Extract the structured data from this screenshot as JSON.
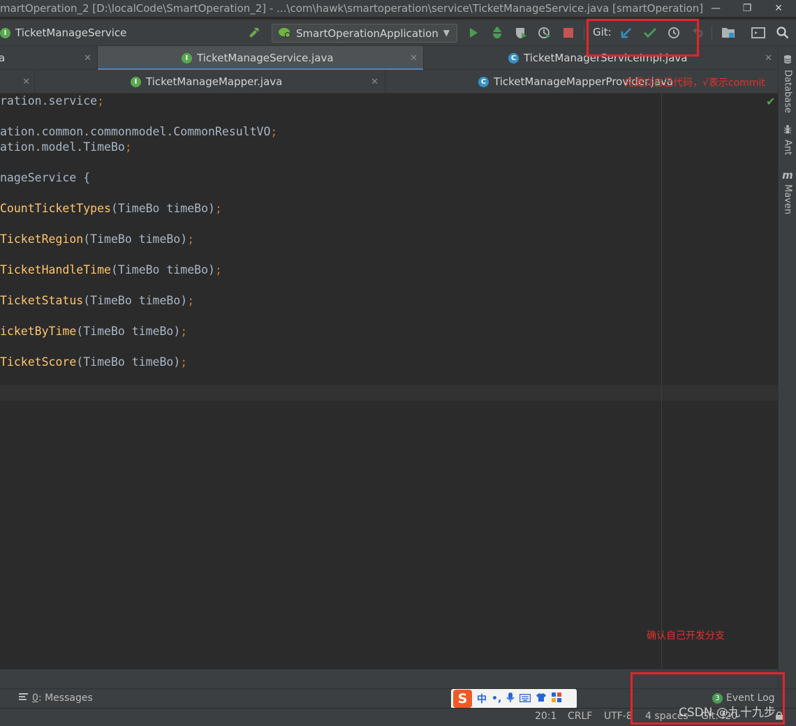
{
  "window": {
    "title": "martOperation_2 [D:\\localCode\\SmartOperation_2] - ...\\com\\hawk\\smartoperation\\service\\TicketManageService.java [smartOperation]",
    "minimize": "—",
    "restore": "❐",
    "close": "✕"
  },
  "navbar": {
    "breadcrumb_class": "TicketManageService",
    "breadcrumb_badge": "I",
    "run_config": "SmartOperationApplication",
    "git_label": "Git:"
  },
  "tabs_row1": [
    {
      "label": "a",
      "badge": "",
      "active": false
    },
    {
      "label": "TicketManageService.java",
      "badge": "I",
      "active": true
    },
    {
      "label": "TicketManagerServiceImpl.java",
      "badge": "C",
      "active": false
    }
  ],
  "tabs_row2": [
    {
      "label": "",
      "badge": ""
    },
    {
      "label": "TicketManageMapper.java",
      "badge": "I"
    },
    {
      "label": "TicketManageMapperProvider.java",
      "badge": "C"
    }
  ],
  "code": [
    {
      "line": 1,
      "text": "ration.service"
    },
    {
      "line": 3,
      "text": "ation.common.commonmodel.CommonResultVO"
    },
    {
      "line": 4,
      "text": "ation.model.TimeBo"
    },
    {
      "line": 6,
      "text": "nageService {"
    },
    {
      "line": 8,
      "fn": "CountTicketTypes",
      "args": "(TimeBo timeBo)"
    },
    {
      "line": 10,
      "fn": "TicketRegion",
      "args": "(TimeBo timeBo)"
    },
    {
      "line": 12,
      "fn": "TicketHandleTime",
      "args": "(TimeBo timeBo)"
    },
    {
      "line": 14,
      "fn": "TicketStatus",
      "args": "(TimeBo timeBo)"
    },
    {
      "line": 16,
      "fn": "icketByTime",
      "args": "(TimeBo timeBo)"
    },
    {
      "line": 18,
      "fn": "TicketScore",
      "args": "(TimeBo timeBo)"
    }
  ],
  "annotations": {
    "top": "先提交自己代码，√表示commit",
    "bottom": "确认自己开发分支"
  },
  "right_tools": [
    {
      "label": "Database",
      "icon": "database-icon"
    },
    {
      "label": "Ant",
      "icon": "ant-icon"
    },
    {
      "label": "Maven",
      "icon": "maven-icon"
    }
  ],
  "tool_windows": {
    "messages_prefix": "0",
    "messages": ": Messages",
    "event_log_count": "3",
    "event_log": "Event Log"
  },
  "ime": {
    "logo": "S",
    "lang": "中",
    "punct": "•,"
  },
  "status": {
    "position": "20:1",
    "line_sep": "CRLF",
    "encoding": "UTF-8",
    "indent": "4 spaces",
    "git": "Git: f20"
  },
  "watermark": "CSDN @九十九步"
}
